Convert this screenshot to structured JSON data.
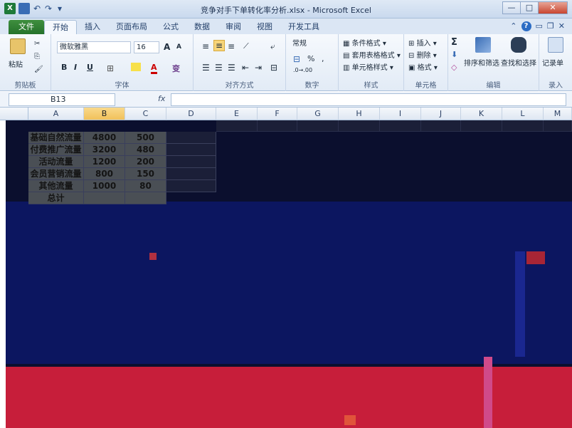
{
  "window": {
    "title": "竞争对手下单转化率分析.xlsx - Microsoft Excel",
    "excel_logo": "X",
    "minimize": "—",
    "maximize": "□",
    "close": "✕"
  },
  "tabs": {
    "file": "文件",
    "items": [
      "开始",
      "插入",
      "页面布局",
      "公式",
      "数据",
      "审阅",
      "视图",
      "开发工具"
    ],
    "active_index": 0
  },
  "ribbon": {
    "clipboard": {
      "paste": "粘贴",
      "label": "剪贴板"
    },
    "font": {
      "font_name": "微软雅黑",
      "font_size": "16",
      "grow": "A",
      "shrink": "A",
      "bold": "B",
      "italic": "I",
      "underline": "U",
      "wen": "变",
      "font_color": "A",
      "label": "字体"
    },
    "alignment": {
      "label": "对齐方式"
    },
    "number": {
      "format": "常规",
      "percent": "%",
      "comma": ",",
      "label": "数字"
    },
    "styles": {
      "conditional": "条件格式",
      "table": "套用表格格式",
      "cell_styles": "单元格样式",
      "label": "样式"
    },
    "cells": {
      "insert": "插入",
      "delete": "删除",
      "format": "格式",
      "label": "单元格"
    },
    "editing": {
      "sum": "Σ",
      "sort": "排序和筛选",
      "find": "查找和选择",
      "label": "编辑"
    },
    "record": {
      "button": "记录单",
      "label": "录入"
    }
  },
  "formula_bar": {
    "name_box": "B13",
    "fx": "fx",
    "value": ""
  },
  "columns": [
    "A",
    "B",
    "C",
    "D",
    "E",
    "F",
    "G",
    "H",
    "I",
    "J",
    "K",
    "L",
    "M"
  ],
  "selected_column": "B",
  "table": {
    "rows": [
      {
        "a": "基础自然流量",
        "b": "4800",
        "c": "500"
      },
      {
        "a": "付费推广流量",
        "b": "3200",
        "c": "480"
      },
      {
        "a": "活动流量",
        "b": "1200",
        "c": "200"
      },
      {
        "a": "会员营销流量",
        "b": "800",
        "c": "150"
      },
      {
        "a": "其他流量",
        "b": "1000",
        "c": "80"
      },
      {
        "a": "总计",
        "b": "",
        "c": ""
      }
    ]
  },
  "colors": {
    "dark_overlay": "#0b0f2e",
    "red_band": "#c71e3a",
    "selected_header": "#f1c15a"
  }
}
